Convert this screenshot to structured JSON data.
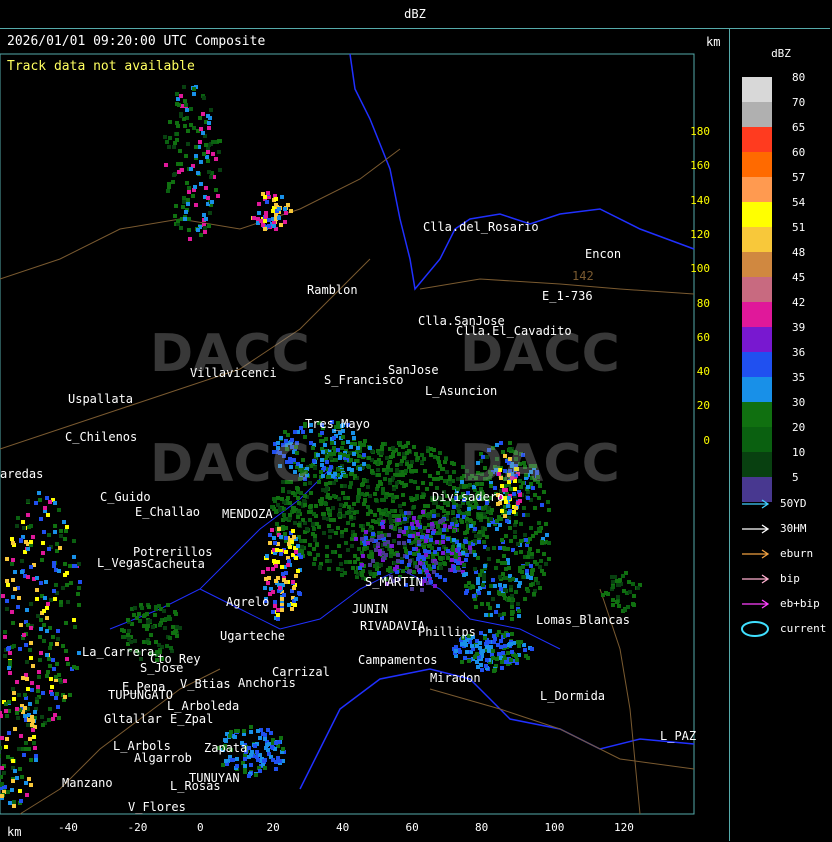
{
  "window": {
    "title": "dBZ"
  },
  "map": {
    "header": "2026/01/01 09:20:00 UTC Composite",
    "track_message": "Track data not available",
    "km_top": "km",
    "km_bottom": "km",
    "y_ticks": [
      "180",
      "160",
      "140",
      "120",
      "100",
      "80",
      "60",
      "40",
      "20",
      "0"
    ],
    "x_ticks": [
      "-40",
      "-20",
      "0",
      "20",
      "40",
      "60",
      "80",
      "100",
      "120"
    ],
    "watermark": "DACC",
    "places": [
      {
        "name": "Clla.del_Rosario"
      },
      {
        "name": "Encon"
      },
      {
        "name": "E_1-736"
      },
      {
        "name": "Ramblon"
      },
      {
        "name": "Clla.SanJose"
      },
      {
        "name": "Clla.El_Cavadito"
      },
      {
        "name": "Villavicenci"
      },
      {
        "name": "S_Francisco"
      },
      {
        "name": "SanJose"
      },
      {
        "name": "L_Asuncion"
      },
      {
        "name": "Uspallata"
      },
      {
        "name": "C_Chilenos"
      },
      {
        "name": "aredas"
      },
      {
        "name": "C_Guido"
      },
      {
        "name": "E_Challao"
      },
      {
        "name": "Tres_Mayo"
      },
      {
        "name": "MENDOZA"
      },
      {
        "name": "Divisadero"
      },
      {
        "name": "Potrerillos"
      },
      {
        "name": "L_Vegas"
      },
      {
        "name": "Cacheuta"
      },
      {
        "name": "Agrelo"
      },
      {
        "name": "S_MARTIN"
      },
      {
        "name": "JUNIN"
      },
      {
        "name": "RIVADAVIA"
      },
      {
        "name": "Phillips"
      },
      {
        "name": "Lomas_Blancas"
      },
      {
        "name": "La_Carrera"
      },
      {
        "name": "Cto_Rey"
      },
      {
        "name": "S_Jose"
      },
      {
        "name": "E_Pena"
      },
      {
        "name": "TUPUNGATO"
      },
      {
        "name": "V_Btias"
      },
      {
        "name": "Anchoris"
      },
      {
        "name": "L_Arboleda"
      },
      {
        "name": "Gltallar"
      },
      {
        "name": "E_Zpal"
      },
      {
        "name": "L_Arbols"
      },
      {
        "name": "Algarrob"
      },
      {
        "name": "Manzano"
      },
      {
        "name": "TUNUYAN"
      },
      {
        "name": "L_Rosas"
      },
      {
        "name": "V_Flores"
      },
      {
        "name": "Miradon"
      },
      {
        "name": "L_Dormida"
      },
      {
        "name": "L_PAZ"
      },
      {
        "name": "Campamentos"
      },
      {
        "name": "Carrizal"
      },
      {
        "name": "Ugarteche"
      },
      {
        "name": "Zapata"
      },
      {
        "name": "142"
      }
    ]
  },
  "legend": {
    "title": "dBZ",
    "colors": [
      {
        "value": "80",
        "color": "#d8d8d8"
      },
      {
        "value": "70",
        "color": "#b0b0b0"
      },
      {
        "value": "65",
        "color": "#ff3b1f"
      },
      {
        "value": "60",
        "color": "#ff6a00"
      },
      {
        "value": "57",
        "color": "#ff9a50"
      },
      {
        "value": "54",
        "color": "#ffff00"
      },
      {
        "value": "51",
        "color": "#f8c83a"
      },
      {
        "value": "48",
        "color": "#d08840"
      },
      {
        "value": "45",
        "color": "#c86a80"
      },
      {
        "value": "42",
        "color": "#e0189a"
      },
      {
        "value": "39",
        "color": "#7818d0"
      },
      {
        "value": "36",
        "color": "#2050f0"
      },
      {
        "value": "35",
        "color": "#1890e8"
      },
      {
        "value": "30",
        "color": "#107010"
      },
      {
        "value": "20",
        "color": "#0a6010"
      },
      {
        "value": "10",
        "color": "#084010"
      },
      {
        "value": "5",
        "color": "#483890"
      }
    ],
    "symbols": [
      {
        "label": "50YD",
        "color": "#40d0ff"
      },
      {
        "label": "30HM",
        "color": "#ffffff"
      },
      {
        "label": "eburn",
        "color": "#f0a040"
      },
      {
        "label": "bip",
        "color": "#ffb0d0"
      },
      {
        "label": "eb+bip",
        "color": "#ff40ff"
      },
      {
        "label": "current",
        "color": "#40e0ff"
      }
    ]
  }
}
